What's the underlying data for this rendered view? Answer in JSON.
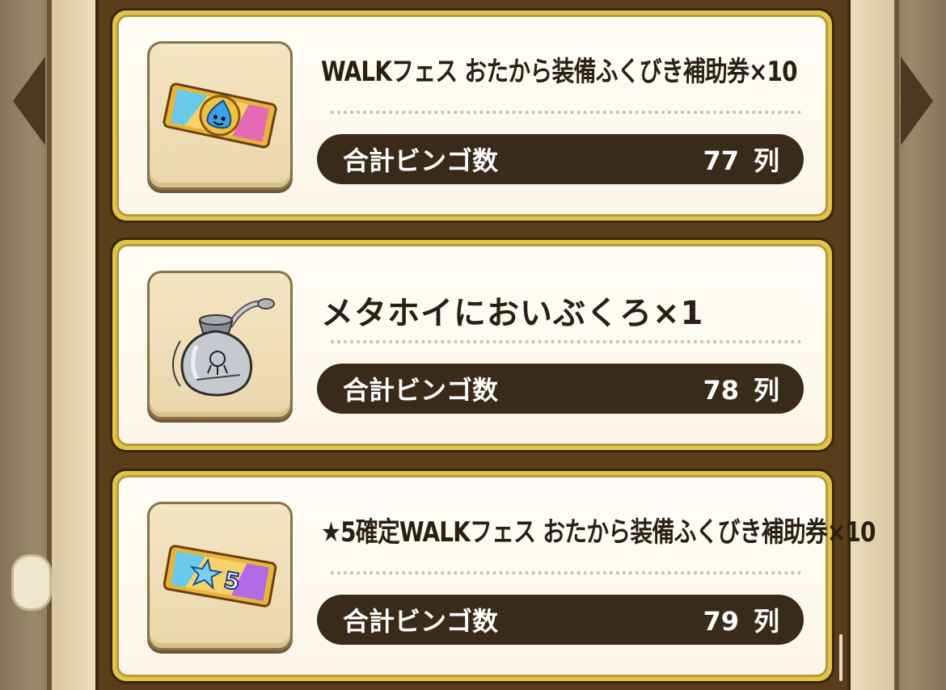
{
  "rewards": [
    {
      "title": "WALKフェス おたから装備ふくびき補助券×10",
      "icon": "blue-slime-ticket-icon",
      "count_label": "合計ビンゴ数",
      "count": "77",
      "unit": "列"
    },
    {
      "title": "メタホイにおいぶくろ×1",
      "icon": "metal-scent-pouch-icon",
      "count_label": "合計ビンゴ数",
      "count": "78",
      "unit": "列"
    },
    {
      "title": "★5確定WALKフェス おたから装備ふくびき補助券×10",
      "icon": "star5-ticket-icon",
      "count_label": "合計ビンゴ数",
      "count": "79",
      "unit": "列"
    }
  ],
  "colors": {
    "card_border": "#e2c44a",
    "pill_bg": "#3a2a1a",
    "panel_bg": "#5a3e1c"
  }
}
